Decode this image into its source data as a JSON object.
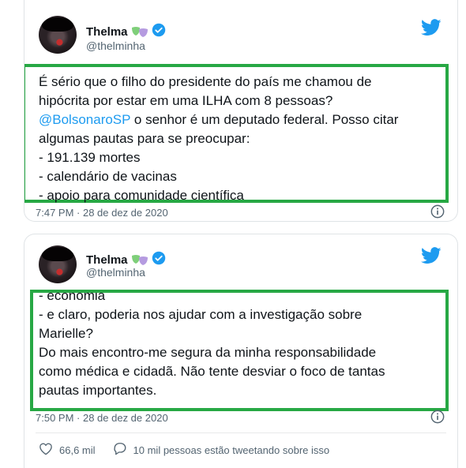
{
  "tweets": [
    {
      "name": "Thelma",
      "name_emoji": "🎭",
      "handle": "@thelminha",
      "lines": [
        "É sério que o filho do presidente do país me chamou de",
        "hipócrita por estar em uma ILHA com 8 pessoas?",
        "o senhor é um deputado federal. Posso citar",
        "algumas pautas para se preocupar:",
        "- 191.139 mortes",
        "- calendário de vacinas",
        "- apoio para comunidade científica"
      ],
      "mention": "@BolsonaroSP",
      "timestamp": "7:47 PM · 28 de dez de 2020"
    },
    {
      "name": "Thelma",
      "name_emoji": "🎭",
      "handle": "@thelminha",
      "lines": [
        "- economia",
        "- e claro, poderia nos ajudar com a investigação sobre",
        "Marielle?",
        "Do mais encontro-me segura da minha responsabilidade",
        "como médica e cidadã. Não tente desviar o foco de tantas",
        "pautas importantes."
      ],
      "timestamp": "7:50 PM · 28 de dez de 2020",
      "likes": "66,6 mil",
      "conversation": "10 mil pessoas estão tweetando sobre isso"
    }
  ],
  "colors": {
    "highlight": "#27a844",
    "twitter_blue": "#1d9bf0",
    "muted": "#536471"
  }
}
